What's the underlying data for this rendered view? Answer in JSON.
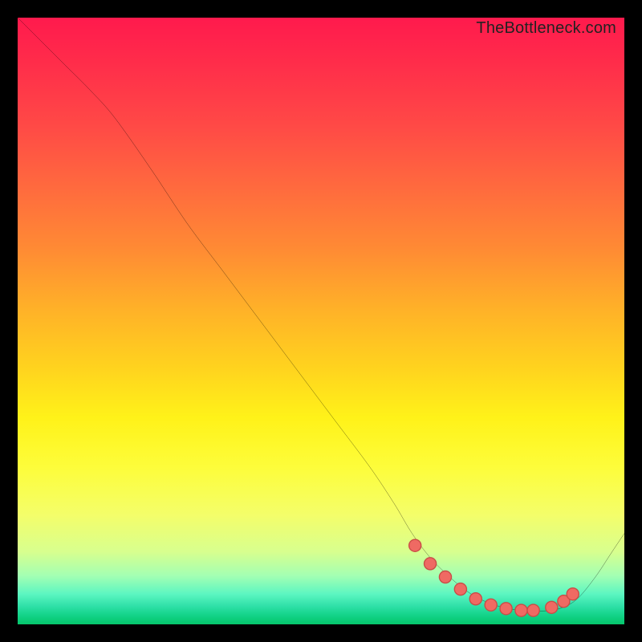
{
  "attribution": "TheBottleneck.com",
  "colors": {
    "curve": "#000000",
    "dot_fill": "#ef6a63",
    "dot_stroke": "#c94c46",
    "background_black": "#000000"
  },
  "chart_data": {
    "type": "line",
    "title": "",
    "xlabel": "",
    "ylabel": "",
    "xlim": [
      0,
      100
    ],
    "ylim": [
      0,
      100
    ],
    "grid": false,
    "legend": false,
    "series": [
      {
        "name": "bottleneck-curve",
        "x": [
          0,
          4,
          8,
          12,
          16,
          22,
          28,
          34,
          40,
          46,
          52,
          58,
          62,
          65,
          68,
          71,
          74,
          77,
          80,
          83,
          86,
          89,
          92,
          95,
          98,
          100
        ],
        "y": [
          100,
          96,
          92,
          88,
          83.5,
          75,
          66,
          58,
          50,
          42,
          34,
          26,
          20,
          15,
          11,
          8,
          5.5,
          3.8,
          2.8,
          2.3,
          2.2,
          2.5,
          4,
          7.5,
          12,
          15
        ]
      }
    ],
    "highlight_points": {
      "name": "bottom-cluster",
      "x": [
        65.5,
        68.0,
        70.5,
        73.0,
        75.5,
        78.0,
        80.5,
        83.0,
        85.0,
        88.0,
        90.0,
        91.5
      ],
      "y": [
        13.0,
        10.0,
        7.8,
        5.8,
        4.2,
        3.2,
        2.6,
        2.3,
        2.3,
        2.8,
        3.8,
        5.0
      ]
    }
  }
}
